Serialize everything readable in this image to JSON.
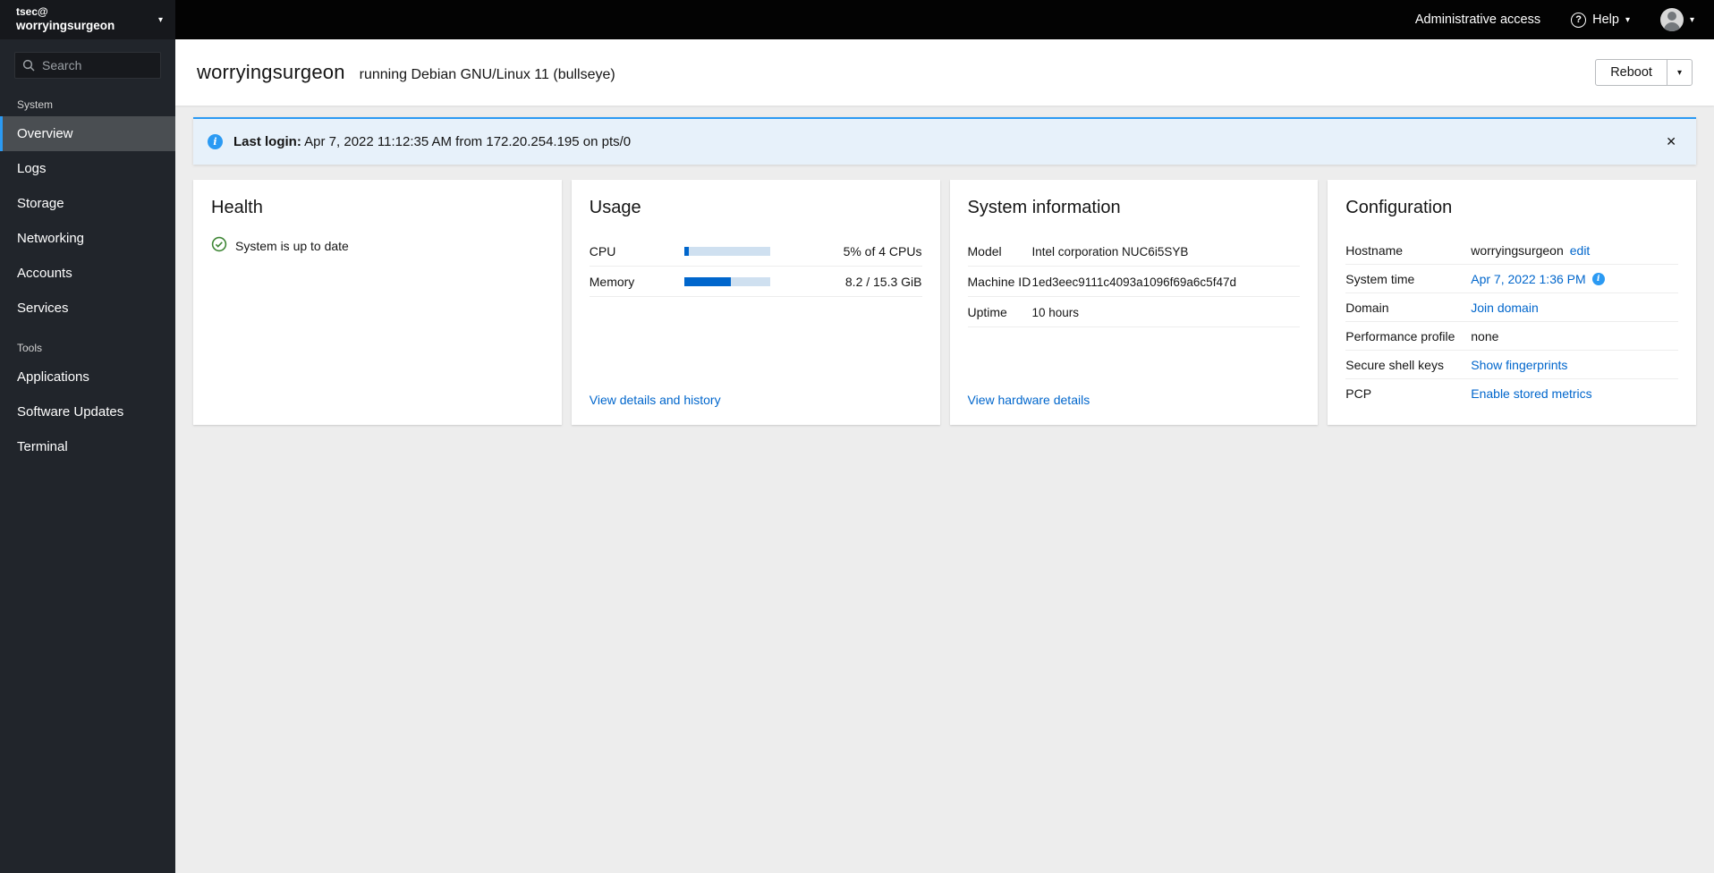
{
  "colors": {
    "accent": "#0066cc",
    "info": "#2b9af3",
    "success": "#3e8635",
    "masthead_bg": "#030303",
    "sidebar_bg": "#21252b",
    "selected_nav_bg": "#4a4e52"
  },
  "icons": {
    "caret": "▾",
    "close": "✕",
    "help": "?",
    "info": "i"
  },
  "masthead": {
    "user": "tsec@",
    "host": "worryingsurgeon",
    "admin_access": "Administrative access",
    "help": "Help"
  },
  "sidebar": {
    "search_placeholder": "Search",
    "sections": [
      {
        "label": "System",
        "items": [
          {
            "label": "Overview",
            "active": true
          },
          {
            "label": "Logs",
            "active": false
          },
          {
            "label": "Storage",
            "active": false
          },
          {
            "label": "Networking",
            "active": false
          },
          {
            "label": "Accounts",
            "active": false
          },
          {
            "label": "Services",
            "active": false
          }
        ]
      },
      {
        "label": "Tools",
        "items": [
          {
            "label": "Applications",
            "active": false
          },
          {
            "label": "Software Updates",
            "active": false
          },
          {
            "label": "Terminal",
            "active": false
          }
        ]
      }
    ]
  },
  "header": {
    "hostname": "worryingsurgeon",
    "os": "running Debian GNU/Linux 11 (bullseye)",
    "reboot_label": "Reboot"
  },
  "alert": {
    "label": "Last login:",
    "text": "Apr 7, 2022 11:12:35 AM from 172.20.254.195 on pts/0"
  },
  "cards": {
    "health": {
      "title": "Health",
      "status": "System is up to date"
    },
    "usage": {
      "title": "Usage",
      "rows": [
        {
          "label": "CPU",
          "percent": 5,
          "value": "5% of 4 CPUs"
        },
        {
          "label": "Memory",
          "percent": 54,
          "value": "8.2 / 15.3 GiB"
        }
      ],
      "link": "View details and history"
    },
    "system_info": {
      "title": "System information",
      "rows": [
        {
          "label": "Model",
          "value": "Intel corporation NUC6i5SYB"
        },
        {
          "label": "Machine ID",
          "value": "1ed3eec9111c4093a1096f69a6c5f47d"
        },
        {
          "label": "Uptime",
          "value": "10 hours"
        }
      ],
      "link": "View hardware details"
    },
    "configuration": {
      "title": "Configuration",
      "hostname": {
        "label": "Hostname",
        "value": "worryingsurgeon",
        "edit": "edit"
      },
      "system_time": {
        "label": "System time",
        "value": "Apr 7, 2022 1:36 PM"
      },
      "domain": {
        "label": "Domain",
        "link": "Join domain"
      },
      "performance_profile": {
        "label": "Performance profile",
        "value": "none"
      },
      "ssh_keys": {
        "label": "Secure shell keys",
        "link": "Show fingerprints"
      },
      "pcp": {
        "label": "PCP",
        "link": "Enable stored metrics"
      }
    }
  }
}
